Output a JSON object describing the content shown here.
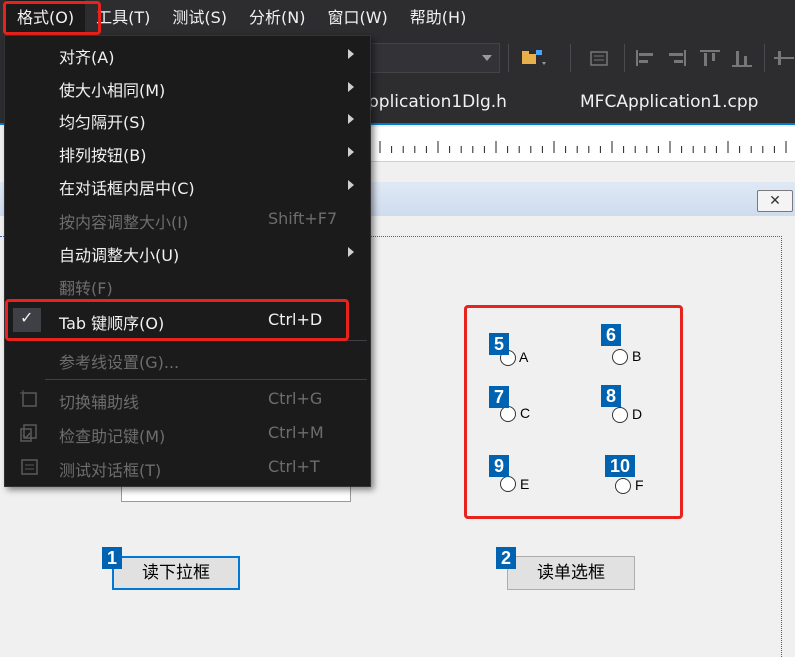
{
  "menubar": {
    "items": [
      "格式(O)",
      "工具(T)",
      "测试(S)",
      "分析(N)",
      "窗口(W)",
      "帮助(H)"
    ]
  },
  "tabs": [
    "pplication1Dlg.h",
    "MFCApplication1.cpp"
  ],
  "dropdown": {
    "items": [
      {
        "label": "对齐(A)",
        "shortcut": "",
        "enabled": true,
        "submenu": true
      },
      {
        "label": "使大小相同(M)",
        "shortcut": "",
        "enabled": true,
        "submenu": true
      },
      {
        "label": "均匀隔开(S)",
        "shortcut": "",
        "enabled": true,
        "submenu": true
      },
      {
        "label": "排列按钮(B)",
        "shortcut": "",
        "enabled": true,
        "submenu": true
      },
      {
        "label": "在对话框内居中(C)",
        "shortcut": "",
        "enabled": true,
        "submenu": true
      },
      {
        "label": "按内容调整大小(I)",
        "shortcut": "Shift+F7",
        "enabled": false,
        "submenu": false
      },
      {
        "label": "自动调整大小(U)",
        "shortcut": "",
        "enabled": true,
        "submenu": true
      },
      {
        "label": "翻转(F)",
        "shortcut": "",
        "enabled": false,
        "submenu": false
      },
      {
        "label": "Tab 键顺序(O)",
        "shortcut": "Ctrl+D",
        "enabled": true,
        "submenu": false,
        "checked": true
      },
      {
        "label": "参考线设置(G)...",
        "shortcut": "",
        "enabled": false,
        "submenu": false
      },
      {
        "label": "切换辅助线",
        "shortcut": "Ctrl+G",
        "enabled": false,
        "submenu": false
      },
      {
        "label": "检查助记键(M)",
        "shortcut": "Ctrl+M",
        "enabled": false,
        "submenu": false
      },
      {
        "label": "测试对话框(T)",
        "shortcut": "Ctrl+T",
        "enabled": false,
        "submenu": false
      }
    ],
    "check_mark": "✓"
  },
  "dialog": {
    "close_glyph": "✕",
    "buttons": [
      {
        "label": "读下拉框",
        "tab_order": "1"
      },
      {
        "label": "读单选框",
        "tab_order": "2"
      }
    ],
    "radios": [
      {
        "label": "A",
        "tab_order": "5"
      },
      {
        "label": "B",
        "tab_order": "6"
      },
      {
        "label": "C",
        "tab_order": "7"
      },
      {
        "label": "D",
        "tab_order": "8"
      },
      {
        "label": "E",
        "tab_order": "9"
      },
      {
        "label": "F",
        "tab_order": "10"
      }
    ]
  },
  "colors": {
    "highlight": "#e8221c",
    "tab_order_badge": "#0063b1",
    "menu_bg": "#1b1b1c",
    "chrome_bg": "#2d2d30"
  }
}
